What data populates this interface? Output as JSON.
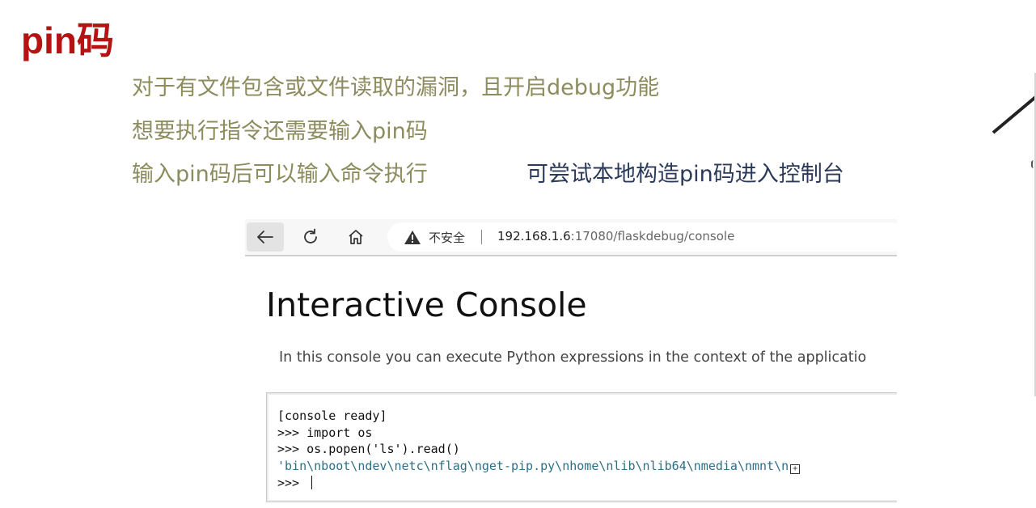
{
  "slide": {
    "title": "pin码",
    "bullets": [
      "对于有文件包含或文件读取的漏洞，且开启debug功能",
      "想要执行指令还需要输入pin码",
      "输入pin码后可以输入命令执行"
    ],
    "note": "可尝试本地构造pin码进入控制台"
  },
  "browser": {
    "security_label": "不安全",
    "url_host": "192.168.1.6",
    "url_rest": ":17080/flaskdebug/console",
    "icons": {
      "back": "arrow-left-icon",
      "reload": "reload-icon",
      "home": "home-icon",
      "warning": "warning-triangle-icon"
    }
  },
  "page": {
    "heading": "Interactive Console",
    "description": "In this console you can execute Python expressions in the context of the applicatio"
  },
  "console": {
    "lines": [
      "[console ready]",
      ">>> import os",
      ">>> os.popen('ls').read()",
      "'bin\\nboot\\ndev\\netc\\nflag\\nget-pip.py\\nhome\\nlib\\nlib64\\nmedia\\nmnt\\n"
    ],
    "prompt": ">>> ",
    "expand_symbol": "+"
  },
  "colors": {
    "title": "#b51212",
    "bullets": "#8c8c5e",
    "note": "#2b3a5a",
    "console_output": "#2d6f87"
  }
}
